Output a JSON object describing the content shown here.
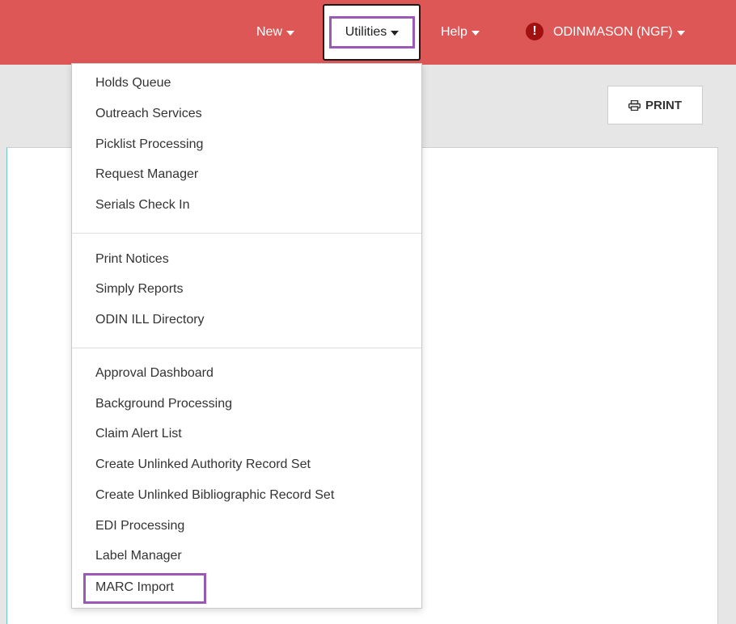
{
  "navbar": {
    "new_label": "New",
    "utilities_label": "Utilities",
    "help_label": "Help",
    "alert_glyph": "!",
    "user_label": "ODINMASON (NGF)",
    "background_color": "#dd5757",
    "highlight_color": "#9b59b6"
  },
  "toolbar": {
    "print_icon": "printer-icon",
    "print_label": "PRINT"
  },
  "utilities_menu": {
    "groups": [
      [
        "Holds Queue",
        "Outreach Services",
        "Picklist Processing",
        "Request Manager",
        "Serials Check In"
      ],
      [
        "Print Notices",
        "Simply Reports",
        "ODIN ILL Directory"
      ],
      [
        "Approval Dashboard",
        "Background Processing",
        "Claim Alert List",
        "Create Unlinked Authority Record Set",
        "Create Unlinked Bibliographic Record Set",
        "EDI Processing",
        "Label Manager",
        "MARC Import"
      ]
    ]
  }
}
